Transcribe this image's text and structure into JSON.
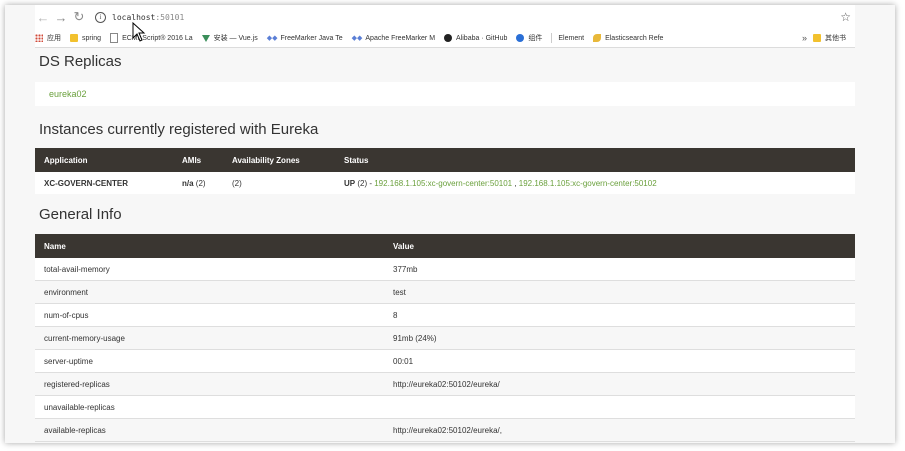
{
  "browser": {
    "url_host": "localhost",
    "url_port": ":50101",
    "bookmarks": [
      {
        "label": "应用",
        "icon": "apps-grid-icon"
      },
      {
        "label": "spring",
        "icon": "folder-icon"
      },
      {
        "label": "ECMAScript® 2016 La",
        "icon": "document-icon"
      },
      {
        "label": "安装 — Vue.js",
        "icon": "vue-icon"
      },
      {
        "label": "FreeMarker Java Te",
        "icon": "diamond-icon"
      },
      {
        "label": "Apache FreeMarker M",
        "icon": "diamond-icon"
      },
      {
        "label": "Alibaba · GitHub",
        "icon": "github-icon"
      },
      {
        "label": "组件",
        "icon": "circle-icon"
      },
      {
        "label": "Element",
        "icon": "none"
      },
      {
        "label": "Elasticsearch Refe",
        "icon": "leaf-icon"
      }
    ],
    "more_label": "»",
    "other_bookmarks": "其他书"
  },
  "ds_replicas": {
    "title": "DS Replicas",
    "items": [
      "eureka02"
    ]
  },
  "instances": {
    "title": "Instances currently registered with Eureka",
    "columns": [
      "Application",
      "AMIs",
      "Availability Zones",
      "Status"
    ],
    "rows": [
      {
        "application": "XC-GOVERN-CENTER",
        "amis_value": "n/a",
        "amis_count": " (2)",
        "zones": "(2)",
        "status_prefix": "UP",
        "status_count": " (2) - ",
        "links": [
          "192.168.1.105:xc-govern-center:50101",
          "192.168.1.105:xc-govern-center:50102"
        ],
        "link_separator": " , "
      }
    ]
  },
  "general_info": {
    "title": "General Info",
    "columns": [
      "Name",
      "Value"
    ],
    "rows": [
      {
        "name": "total-avail-memory",
        "value": "377mb"
      },
      {
        "name": "environment",
        "value": "test"
      },
      {
        "name": "num-of-cpus",
        "value": "8"
      },
      {
        "name": "current-memory-usage",
        "value": "91mb (24%)"
      },
      {
        "name": "server-uptime",
        "value": "00:01"
      },
      {
        "name": "registered-replicas",
        "value": "http://eureka02:50102/eureka/"
      },
      {
        "name": "unavailable-replicas",
        "value": ""
      },
      {
        "name": "available-replicas",
        "value": "http://eureka02:50102/eureka/,"
      }
    ]
  }
}
